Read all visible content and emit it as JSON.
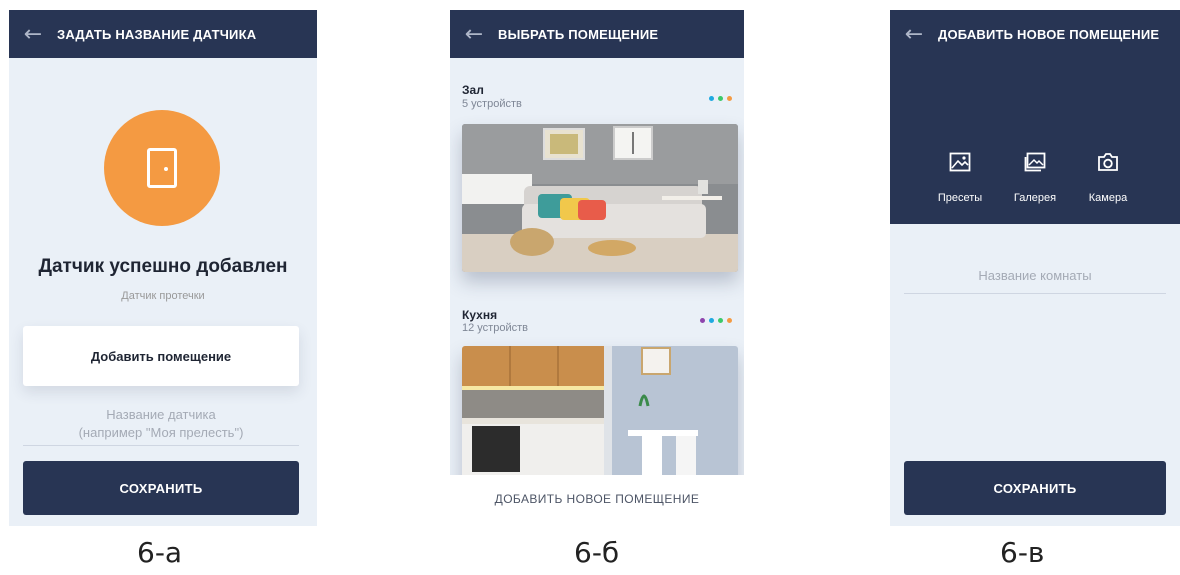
{
  "screen_a": {
    "header_title": "ЗАДАТЬ НАЗВАНИЕ ДАТЧИКА",
    "success_title": "Датчик успешно добавлен",
    "sensor_type": "Датчик протечки",
    "add_room_label": "Добавить помещение",
    "name_placeholder_line1": "Название датчика",
    "name_placeholder_line2": "(например \"Моя прелесть\")",
    "save_label": "СОХРАНИТЬ",
    "accent_color": "#f49a42"
  },
  "screen_b": {
    "header_title": "ВЫБРАТЬ ПОМЕЩЕНИЕ",
    "rooms": [
      {
        "name": "Зал",
        "count": "5 устройств",
        "dot_colors": [
          "#1fa9e0",
          "#3cc96a",
          "#f49a42"
        ]
      },
      {
        "name": "Кухня",
        "count": "12 устройств",
        "dot_colors": [
          "#8e44ad",
          "#1fa9e0",
          "#3cc96a",
          "#f49a42"
        ]
      }
    ],
    "add_new_label": "ДОБАВИТЬ НОВОЕ ПОМЕЩЕНИЕ"
  },
  "screen_c": {
    "header_title": "ДОБАВИТЬ НОВОЕ ПОМЕЩЕНИЕ",
    "sources": [
      {
        "label": "Пресеты",
        "icon": "presets-image-icon"
      },
      {
        "label": "Галерея",
        "icon": "gallery-image-icon"
      },
      {
        "label": "Камера",
        "icon": "camera-icon"
      }
    ],
    "room_name_placeholder": "Название комнаты",
    "save_label": "СОХРАНИТЬ"
  },
  "captions": [
    "6-а",
    "6-б",
    "6-в"
  ],
  "colors": {
    "header": "#283554",
    "background": "#eaf0f7"
  }
}
